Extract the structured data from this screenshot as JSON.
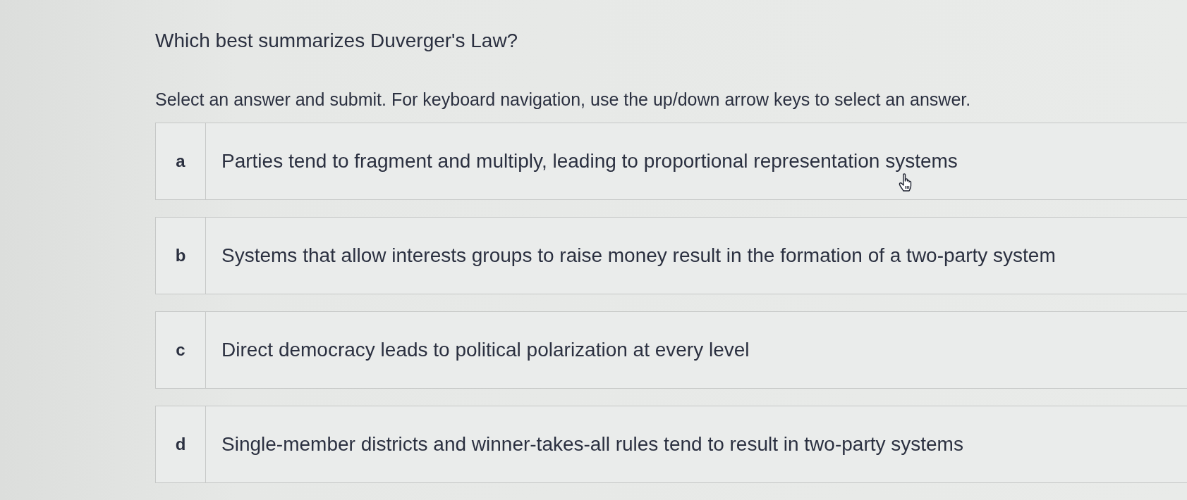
{
  "question": "Which best summarizes Duverger's Law?",
  "instructions": "Select an answer and submit. For keyboard navigation, use the up/down arrow keys to select an answer.",
  "options": [
    {
      "letter": "a",
      "text": "Parties tend to fragment and multiply, leading to proportional representation systems",
      "selected": false
    },
    {
      "letter": "b",
      "text": "Systems that allow interests groups to raise money result in the formation of a two-party system",
      "selected": false
    },
    {
      "letter": "c",
      "text": "Direct democracy leads to political polarization at every level",
      "selected": false
    },
    {
      "letter": "d",
      "text": "Single-member districts and winner-takes-all rules tend to result in two-party systems",
      "selected": false
    }
  ]
}
